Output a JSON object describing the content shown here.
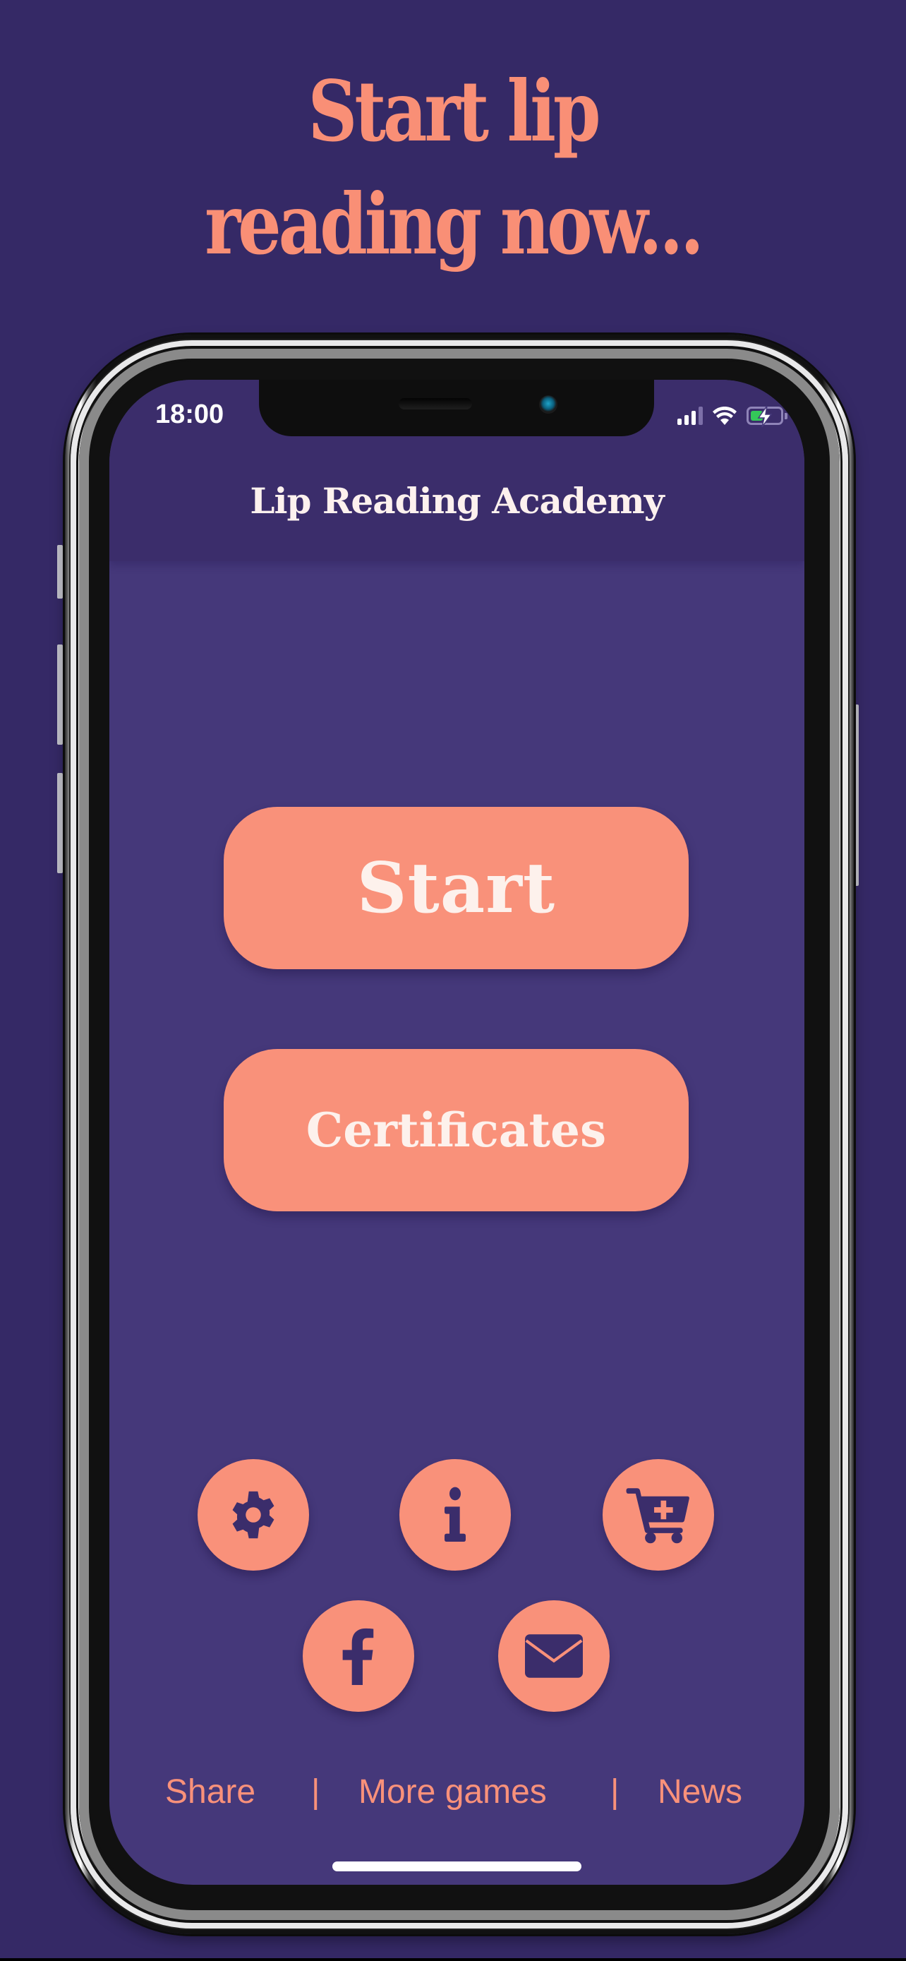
{
  "promo": {
    "headline_line1": "Start lip",
    "headline_line2": "reading now..."
  },
  "status_bar": {
    "time": "18:00",
    "signal_bars_filled": 3,
    "signal_bars_total": 4,
    "wifi": "connected",
    "battery_charging": true,
    "battery_level_percent": 40
  },
  "app": {
    "title": "Lip Reading Academy"
  },
  "main_buttons": {
    "start_label": "Start",
    "certificates_label": "Certificates"
  },
  "icon_buttons": [
    {
      "name": "settings",
      "icon": "gear-icon"
    },
    {
      "name": "info",
      "icon": "info-icon"
    },
    {
      "name": "store",
      "icon": "cart-plus-icon"
    },
    {
      "name": "facebook",
      "icon": "facebook-icon"
    },
    {
      "name": "email",
      "icon": "envelope-icon"
    }
  ],
  "footer": {
    "share_label": "Share",
    "separator": "|",
    "more_games_label": "More games",
    "news_label": "News"
  },
  "colors": {
    "background": "#352966",
    "header": "#3b2d6b",
    "screen": "#45387a",
    "accent": "#f9917a",
    "icon": "#3b2d6b",
    "text_light": "#fdf1ee",
    "battery_green": "#34c759"
  }
}
